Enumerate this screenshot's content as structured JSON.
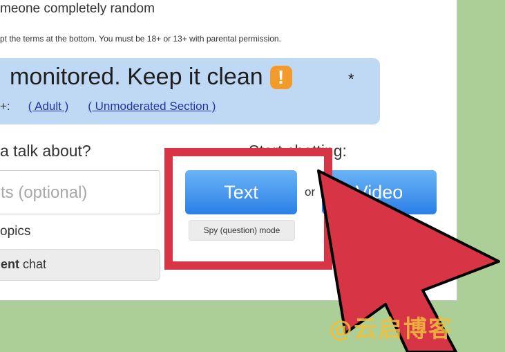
{
  "intro_text": "meone completely random",
  "terms_text": "pt the terms at the bottom. You must be 18+ or 13+ with parental permission.",
  "banner": {
    "title": "monitored. Keep it clean",
    "warning_glyph": "!",
    "asterisk": "*",
    "prefix": "+:",
    "adult_link": "( Adult )",
    "unmoderated_link": "( Unmoderated Section )"
  },
  "left": {
    "heading": "a talk about?",
    "interests_placeholder": "ts (optional)",
    "topics_label": "opics",
    "chat_button_bold": "ent",
    "chat_button_rest": " chat"
  },
  "right": {
    "heading": "Start chatting:",
    "text_button": "Text",
    "or_label": "or",
    "video_button": "Video",
    "spy_mode_button": "Spy (question) mode"
  },
  "colors": {
    "highlight": "#d73445",
    "button_blue": "#2b7fe6",
    "background_green": "#abcf97",
    "banner_blue": "#bfd9f5"
  },
  "watermark": "@云启博客"
}
